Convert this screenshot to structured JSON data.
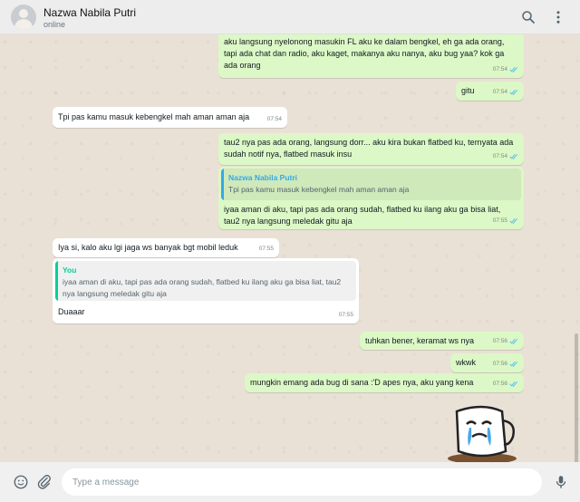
{
  "header": {
    "contact_name": "Nazwa Nabila Putri",
    "status": "online"
  },
  "icons": {
    "search": "search-icon",
    "menu": "kebab-menu-icon",
    "emoji": "emoji-icon",
    "attach": "paperclip-icon",
    "mic": "microphone-icon"
  },
  "colors": {
    "outgoing": "#dcf8c6",
    "incoming": "#ffffff",
    "read_ticks": "#53bdeb",
    "quote_you": "#06cf9c",
    "quote_contact": "#35a9e6"
  },
  "messages": [
    {
      "dir": "out",
      "text": "aku langsung nyelonong masukin FL aku ke dalam bengkel, eh ga ada orang,\ntapi ada chat dan radio, aku kaget, makanya aku nanya, aku bug yaa? kok ga\nada orang",
      "time": "07:54"
    },
    {
      "dir": "out",
      "text": "gitu",
      "time": "07:54"
    },
    {
      "dir": "in",
      "text": "Tpi pas kamu masuk kebengkel mah aman aman aja",
      "time": "07:54"
    },
    {
      "dir": "out",
      "text": "tau2 nya pas ada orang, langsung dorr... aku kira bukan flatbed ku, ternyata ada\nsudah notif nya, flatbed masuk insu",
      "time": "07:54"
    },
    {
      "dir": "out",
      "quote_name": "Nazwa Nabila Putri",
      "quote_text": "Tpi pas kamu masuk kebengkel mah aman aman aja",
      "text": "iyaa aman di aku, tapi pas ada orang sudah, flatbed ku ilang aku ga bisa liat,\ntau2 nya langsung meledak gitu aja",
      "time": "07:55"
    },
    {
      "dir": "in",
      "text": "Iya si, kalo aku lgi jaga ws banyak bgt mobil leduk",
      "time": "07:55"
    },
    {
      "dir": "in",
      "quote_name": "You",
      "quote_text": "iyaa aman di aku, tapi pas ada orang sudah, flatbed ku ilang aku ga bisa liat, tau2\nnya langsung meledak gitu aja",
      "text": "Duaaar",
      "time": "07:55"
    },
    {
      "dir": "out",
      "text": "tuhkan bener, keramat ws nya",
      "time": "07:56"
    },
    {
      "dir": "out",
      "text": "wkwk",
      "time": "07:56"
    },
    {
      "dir": "out",
      "text": "mungkin emang ada bug di sana :'D apes nya, aku yang kena",
      "time": "07:56"
    }
  ],
  "sticker": {
    "name": "crying-cup-sticker"
  },
  "composer": {
    "placeholder": "Type a message"
  }
}
